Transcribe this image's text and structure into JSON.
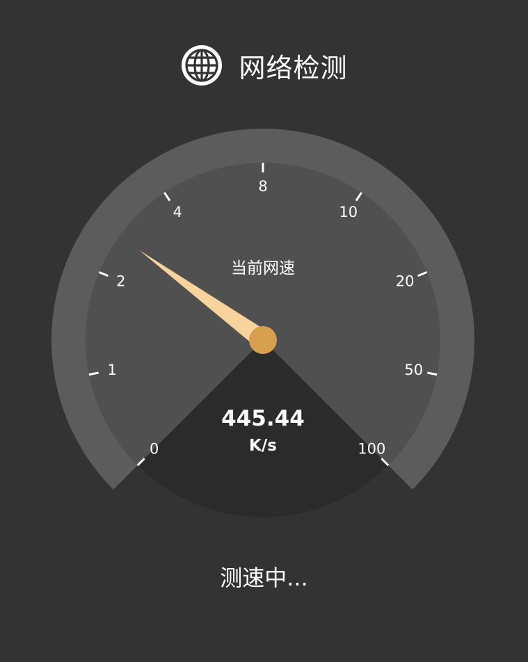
{
  "header": {
    "title": "网络检测",
    "icon": "globe-icon"
  },
  "gauge": {
    "caption": "当前网速",
    "tick_labels": [
      "0",
      "1",
      "2",
      "4",
      "8",
      "10",
      "20",
      "50",
      "100"
    ],
    "speed_value": "445.44",
    "speed_unit": "K/s",
    "needle_tick_position": 0.3,
    "colors": {
      "outer_ring": "#5c5c5c",
      "dial_face": "#505050",
      "bottom_sector": "#2b2b2b",
      "needle": "#f8d39c",
      "needle_hub": "#d7a04e",
      "ticks": "#ffffff"
    }
  },
  "status": {
    "text": "测速中..."
  }
}
